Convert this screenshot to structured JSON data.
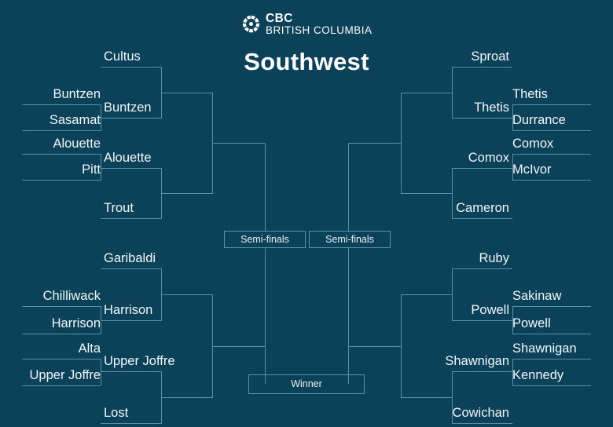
{
  "header": {
    "logo_icon": "cbc-gem-icon",
    "brand": "CBC",
    "region": "BRITISH COLUMBIA",
    "title": "Southwest"
  },
  "colors": {
    "background": "#0c4259",
    "line": "#5b8fa4",
    "text": "#f2f7f9",
    "brand_white": "#ffffff"
  },
  "center": {
    "semifinal_left": "Semi-finals",
    "semifinal_right": "Semi-finals",
    "winner": "Winner"
  },
  "bracket": {
    "left": {
      "round1": [
        {
          "top": "Buntzen",
          "bottom": "Sasamat"
        },
        {
          "top": "Alouette",
          "bottom": "Pitt"
        },
        {
          "top": "Chilliwack",
          "bottom": "Harrison"
        },
        {
          "top": "Alta",
          "bottom": "Upper Joffre"
        }
      ],
      "round2": [
        {
          "top": "Cultus",
          "bottom": "Buntzen"
        },
        {
          "top": "Alouette",
          "bottom": "Trout"
        },
        {
          "top": "Garibaldi",
          "bottom": "Harrison"
        },
        {
          "top": "Upper Joffre",
          "bottom": "Lost"
        }
      ]
    },
    "right": {
      "round1": [
        {
          "top": "Thetis",
          "bottom": "Durrance"
        },
        {
          "top": "Comox",
          "bottom": "McIvor"
        },
        {
          "top": "Sakinaw",
          "bottom": "Powell"
        },
        {
          "top": "Shawnigan",
          "bottom": "Kennedy"
        }
      ],
      "round2": [
        {
          "top": "Sproat",
          "bottom": "Thetis"
        },
        {
          "top": "Comox",
          "bottom": "Cameron"
        },
        {
          "top": "Ruby",
          "bottom": "Powell"
        },
        {
          "top": "Shawnigan",
          "bottom": "Cowichan"
        }
      ]
    }
  }
}
